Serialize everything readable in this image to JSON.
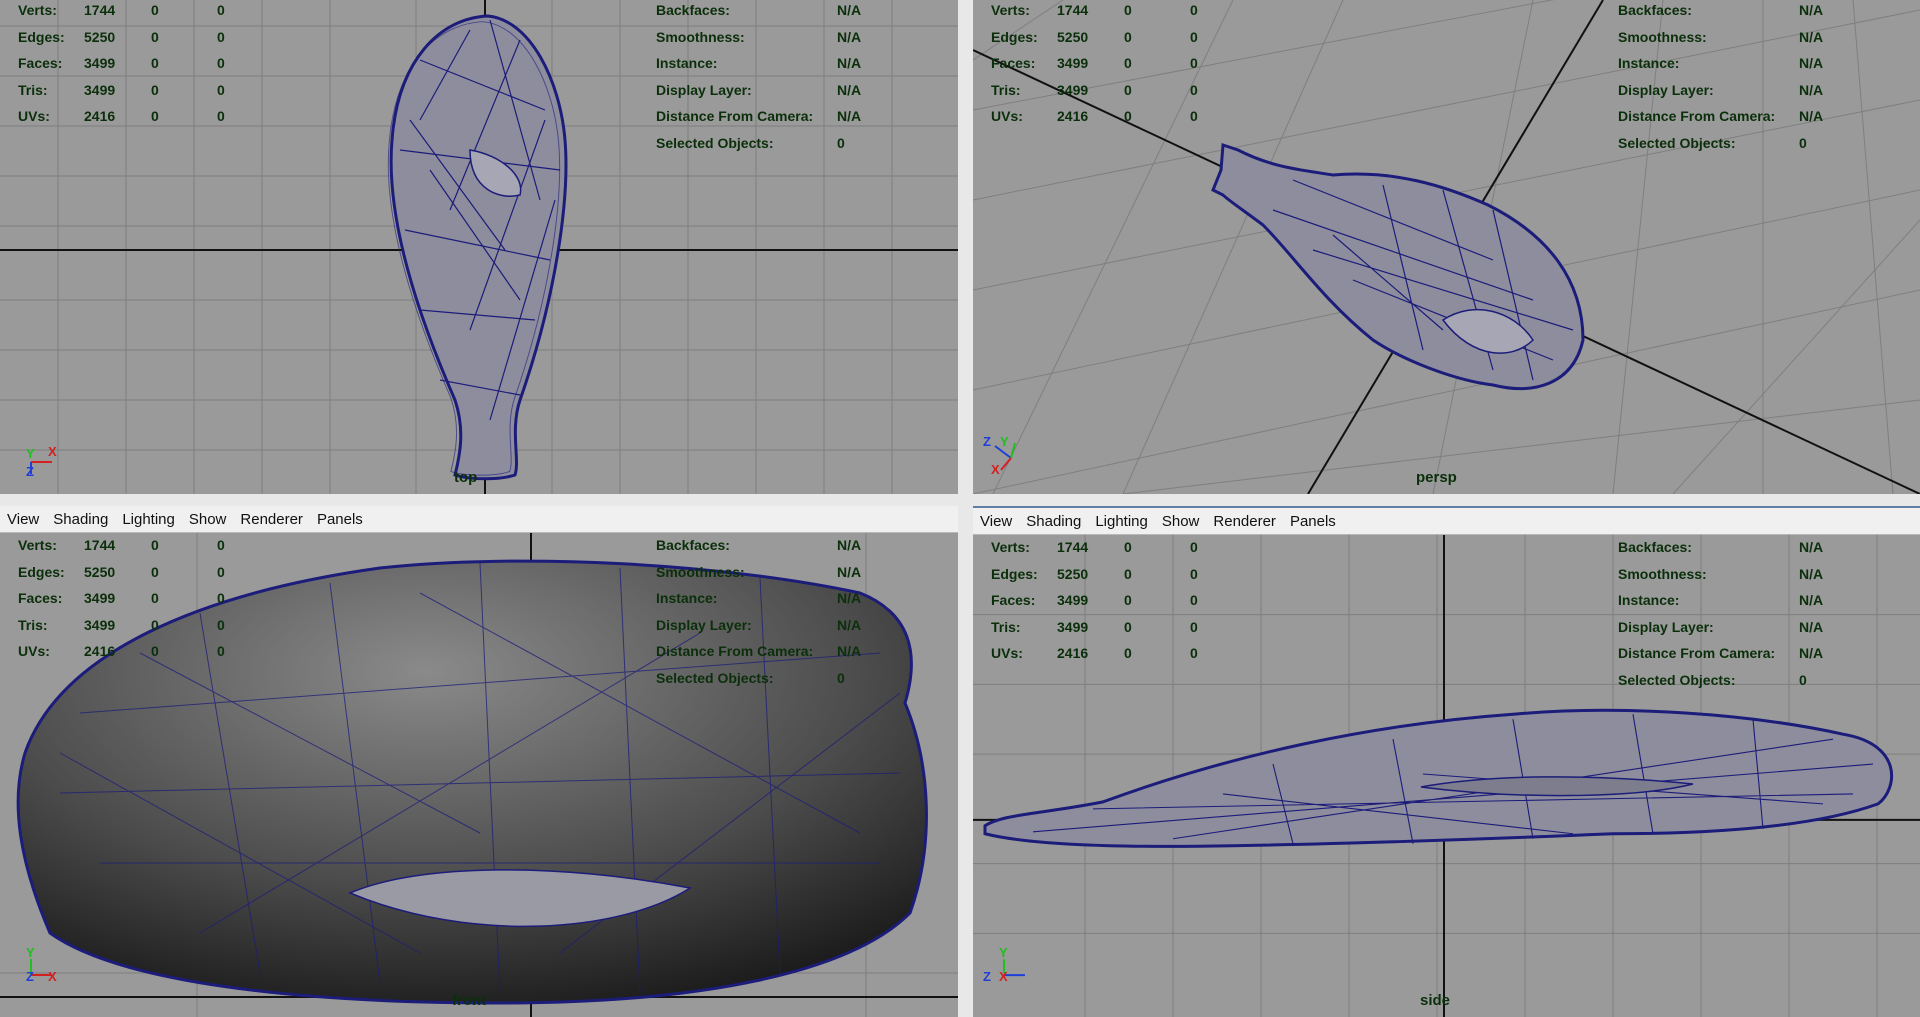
{
  "menus": [
    "View",
    "Shading",
    "Lighting",
    "Show",
    "Renderer",
    "Panels"
  ],
  "hud_left": [
    {
      "label": "Verts:",
      "values": [
        "1744",
        "0",
        "0"
      ]
    },
    {
      "label": "Edges:",
      "values": [
        "5250",
        "0",
        "0"
      ]
    },
    {
      "label": "Faces:",
      "values": [
        "3499",
        "0",
        "0"
      ]
    },
    {
      "label": "Tris:",
      "values": [
        "3499",
        "0",
        "0"
      ]
    },
    {
      "label": "UVs:",
      "values": [
        "2416",
        "0",
        "0"
      ]
    }
  ],
  "hud_right": [
    {
      "label": "Backfaces:",
      "value": "N/A"
    },
    {
      "label": "Smoothness:",
      "value": "N/A"
    },
    {
      "label": "Instance:",
      "value": "N/A"
    },
    {
      "label": "Display Layer:",
      "value": "N/A"
    },
    {
      "label": "Distance From Camera:",
      "value": "N/A"
    },
    {
      "label": "Selected Objects:",
      "value": "0"
    }
  ],
  "cameras": {
    "top": "top",
    "persp": "persp",
    "front": "front",
    "side": "side"
  },
  "axes": {
    "x": "X",
    "y": "Y",
    "z": "Z"
  },
  "colors": {
    "viewport_bg": "#9a9a9a",
    "grid": "#7f7f7f",
    "hud_text": "#0b2f0b",
    "wireframe": "#1c1c7a",
    "axis_x": "#d42020",
    "axis_y": "#1fbf1f",
    "axis_z": "#1f3fd8"
  }
}
